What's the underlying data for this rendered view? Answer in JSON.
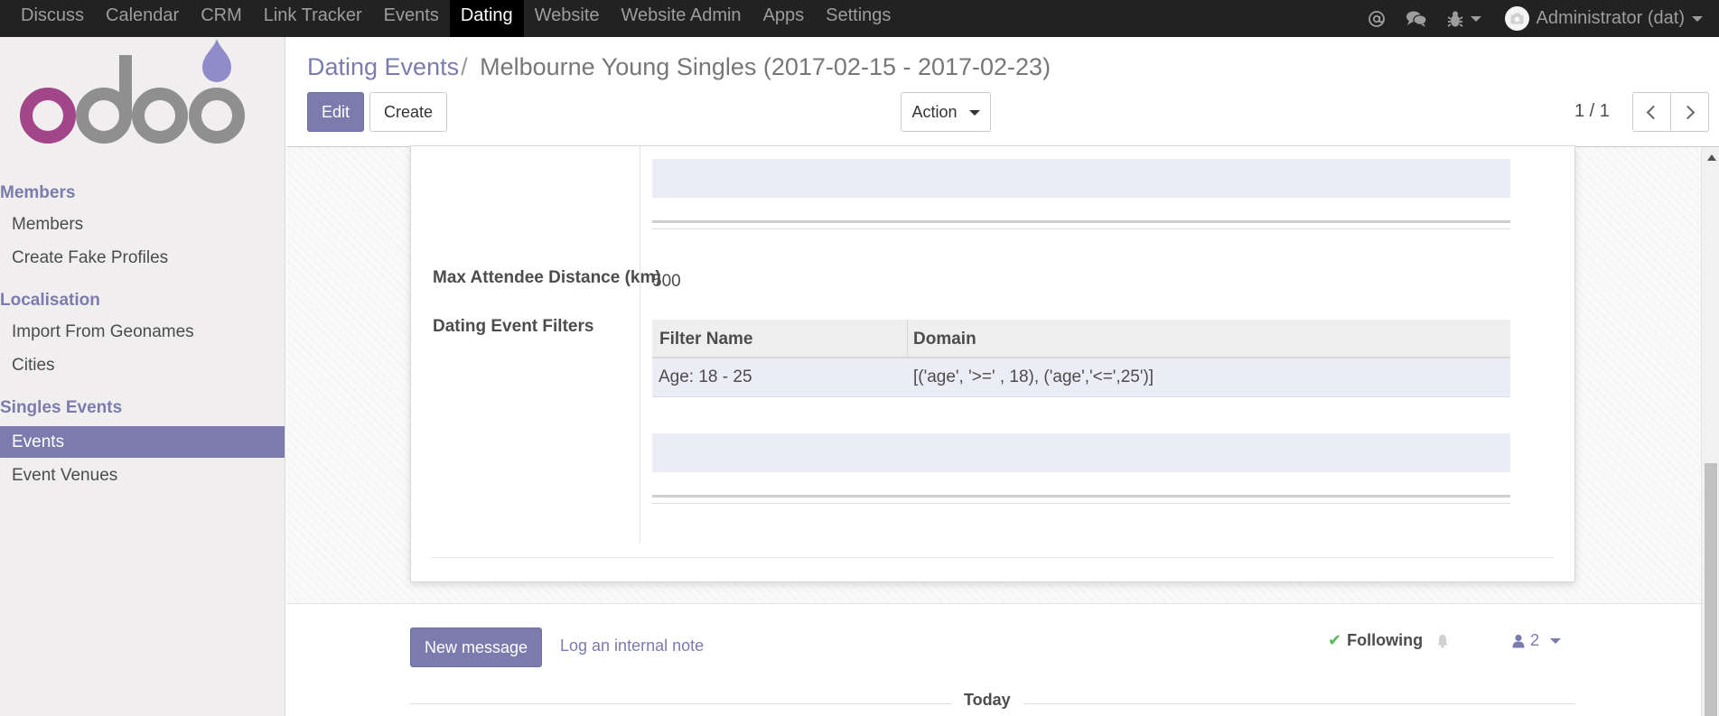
{
  "navbar": {
    "apps": [
      "Discuss",
      "Calendar",
      "CRM",
      "Link Tracker",
      "Events",
      "Dating",
      "Website",
      "Website Admin",
      "Apps",
      "Settings"
    ],
    "active_app": "Dating",
    "user": "Administrator (dat)",
    "icons": [
      "at-icon",
      "chat-icon",
      "bug-icon"
    ]
  },
  "sidebar": {
    "logo": "odoo",
    "sections": [
      {
        "title": "Members",
        "items": [
          "Members",
          "Create Fake Profiles"
        ]
      },
      {
        "title": "Localisation",
        "items": [
          "Import From Geonames",
          "Cities"
        ]
      },
      {
        "title": "Singles Events",
        "items": [
          "Events",
          "Event Venues"
        ]
      }
    ],
    "active_item": "Events"
  },
  "control_panel": {
    "breadcrumb_parent": "Dating Events",
    "breadcrumb_sep": "/",
    "breadcrumb_current": "Melbourne Young Singles (2017-02-15 - 2017-02-23)",
    "edit_label": "Edit",
    "create_label": "Create",
    "action_label": "Action",
    "pager": "1 / 1"
  },
  "form": {
    "max_distance_label": "Max Attendee Distance (km)",
    "max_distance_value": "500",
    "filters_label": "Dating Event Filters",
    "filters_table": {
      "columns": [
        "Filter Name",
        "Domain"
      ],
      "rows": [
        {
          "name": "Age: 18 - 25",
          "domain": "[('age', '>=' , 18), ('age','<=',25')]"
        }
      ]
    }
  },
  "chatter": {
    "new_message_label": "New message",
    "log_note_label": "Log an internal note",
    "following_label": "Following",
    "followers_count": "2",
    "today_label": "Today"
  },
  "colors": {
    "brand": "#7c7bad",
    "navbar_bg": "#222222",
    "following_check": "#5cb85c"
  }
}
